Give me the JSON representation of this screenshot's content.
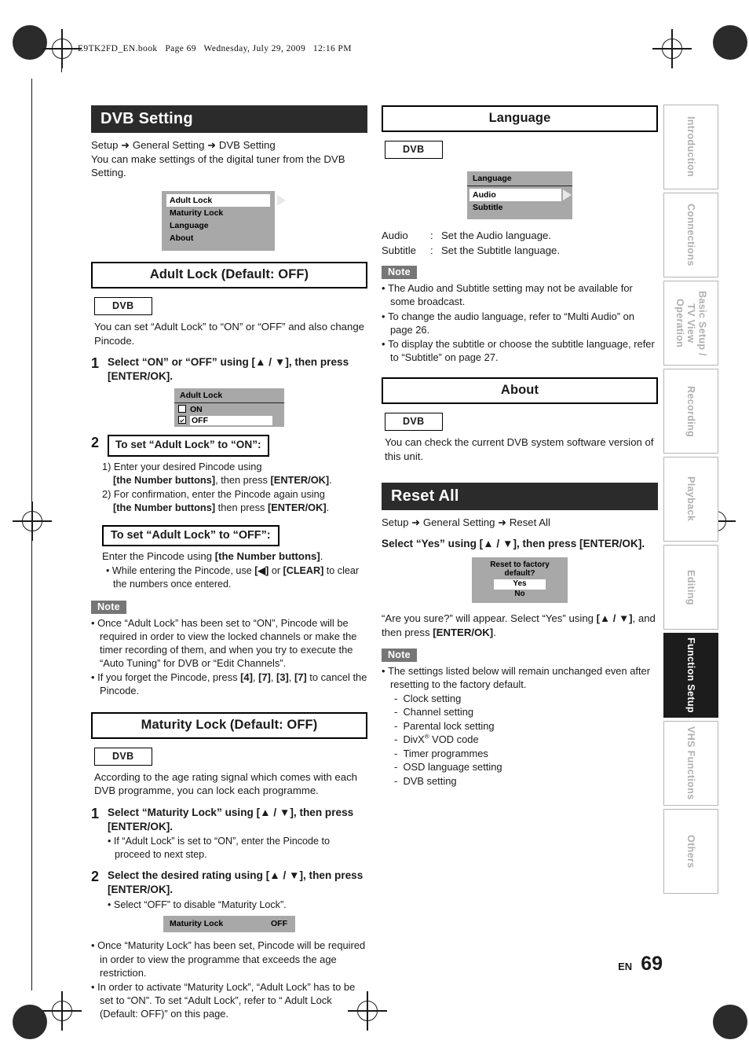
{
  "header": {
    "book_line": "E9TK2FD_EN.book   Page 69   Wednesday, July 29, 2009   12:16 PM"
  },
  "footer": {
    "lang_code": "EN",
    "page_number": "69"
  },
  "side_tabs": [
    {
      "label": "Introduction",
      "active": false
    },
    {
      "label": "Connections",
      "active": false
    },
    {
      "label": "Basic Setup /\nTV View Operation",
      "active": false
    },
    {
      "label": "Recording",
      "active": false
    },
    {
      "label": "Playback",
      "active": false
    },
    {
      "label": "Editing",
      "active": false
    },
    {
      "label": "Function Setup",
      "active": true
    },
    {
      "label": "VHS Functions",
      "active": false
    },
    {
      "label": "Others",
      "active": false
    }
  ],
  "left_column": {
    "dvb_setting": {
      "title": "DVB Setting",
      "breadcrumb": "Setup ➜ General Setting ➜ DVB Setting",
      "intro": "You can make settings of the digital tuner from the DVB Setting.",
      "osd": {
        "rows": [
          "Adult Lock",
          "Maturity Lock",
          "Language",
          "About"
        ],
        "selected_index": 0
      }
    },
    "adult_lock": {
      "title": "Adult Lock (Default: OFF)",
      "chip": "DVB",
      "intro": "You can set “Adult Lock” to “ON” or “OFF” and also change Pincode.",
      "step1": {
        "num": "1",
        "text": "Select “ON” or “OFF” using [▲ / ▼], then press [ENTER/OK]."
      },
      "osd": {
        "title": "Adult Lock",
        "options": [
          {
            "label": "ON",
            "checked": false,
            "selected": false
          },
          {
            "label": "OFF",
            "checked": true,
            "selected": true
          }
        ]
      },
      "step2": {
        "num": "2",
        "boxed": "To set “Adult Lock” to “ON”:",
        "sub1_a": "1) Enter your desired Pincode using",
        "sub1_b": "[the Number buttons], then press [ENTER/OK].",
        "sub2_a": "2) For confirmation, enter the Pincode again using",
        "sub2_b": "[the Number buttons] then press [ENTER/OK]."
      },
      "off_box": {
        "boxed": "To set “Adult Lock” to “OFF”:",
        "line": "Enter the Pincode using [the Number buttons].",
        "bullet": "While entering the Pincode, use [◀] or [CLEAR] to clear the numbers once entered."
      },
      "note_label": "Note",
      "notes": [
        "Once “Adult Lock” has been set to “ON”, Pincode will be required in order to view the locked channels or make the timer recording of them, and when you try to execute the “Auto Tuning” for DVB or “Edit Channels”.",
        "If you forget the Pincode, press [4], [7], [3], [7] to cancel the Pincode."
      ]
    },
    "maturity_lock": {
      "title": "Maturity Lock (Default: OFF)",
      "chip": "DVB",
      "intro": "According to the age rating signal which comes with each DVB programme, you can lock each programme.",
      "step1": {
        "num": "1",
        "text": "Select “Maturity Lock” using [▲ / ▼], then press [ENTER/OK].",
        "bullet": "If “Adult Lock” is set to “ON”, enter the Pincode to proceed to next step."
      },
      "step2": {
        "num": "2",
        "text": "Select the desired rating using [▲ / ▼], then press [ENTER/OK].",
        "bullet": "Select “OFF” to disable “Maturity Lock”."
      },
      "osd_bar": {
        "label": "Maturity Lock",
        "value": "OFF"
      },
      "bullets": [
        "Once “Maturity Lock” has been set, Pincode will be required in order to view the programme that exceeds the age restriction.",
        "In order to activate “Maturity Lock”, “Adult Lock” has to be set to “ON”. To set “Adult Lock”, refer to “    Adult Lock (Default: OFF)” on this page."
      ]
    }
  },
  "right_column": {
    "language": {
      "title": "Language",
      "chip": "DVB",
      "osd": {
        "title": "Language",
        "rows": [
          "Audio",
          "Subtitle"
        ],
        "selected_index": 0
      },
      "defs": [
        {
          "term": "Audio",
          "sep": ":",
          "desc": "Set the Audio language."
        },
        {
          "term": "Subtitle",
          "sep": ":",
          "desc": "Set the Subtitle language."
        }
      ],
      "note_label": "Note",
      "notes": [
        "The Audio and Subtitle setting may not be available for some broadcast.",
        "To change the audio language, refer to “Multi Audio” on page 26.",
        "To display the subtitle or choose the subtitle language, refer to “Subtitle” on page 27."
      ]
    },
    "about": {
      "title": "About",
      "chip": "DVB",
      "body": "You can check the current DVB system software version of this unit."
    },
    "reset_all": {
      "title": "Reset All",
      "breadcrumb": "Setup ➜ General Setting ➜ Reset All",
      "instruction": "Select “Yes” using [▲ / ▼], then press [ENTER/OK].",
      "osd_dialog": {
        "question": "Reset to factory default?",
        "options": [
          {
            "label": "Yes",
            "selected": true
          },
          {
            "label": "No",
            "selected": false
          }
        ]
      },
      "after_text": "“Are you sure?” will appear. Select “Yes” using [▲ / ▼], and then press [ENTER/OK].",
      "note_label": "Note",
      "note_main": "The settings listed below will remain unchanged even after resetting to the factory default.",
      "note_items": [
        "Clock setting",
        "Channel setting",
        "Parental lock setting",
        "DivX® VOD code",
        "Timer programmes",
        "OSD language setting",
        "DVB setting"
      ]
    }
  }
}
